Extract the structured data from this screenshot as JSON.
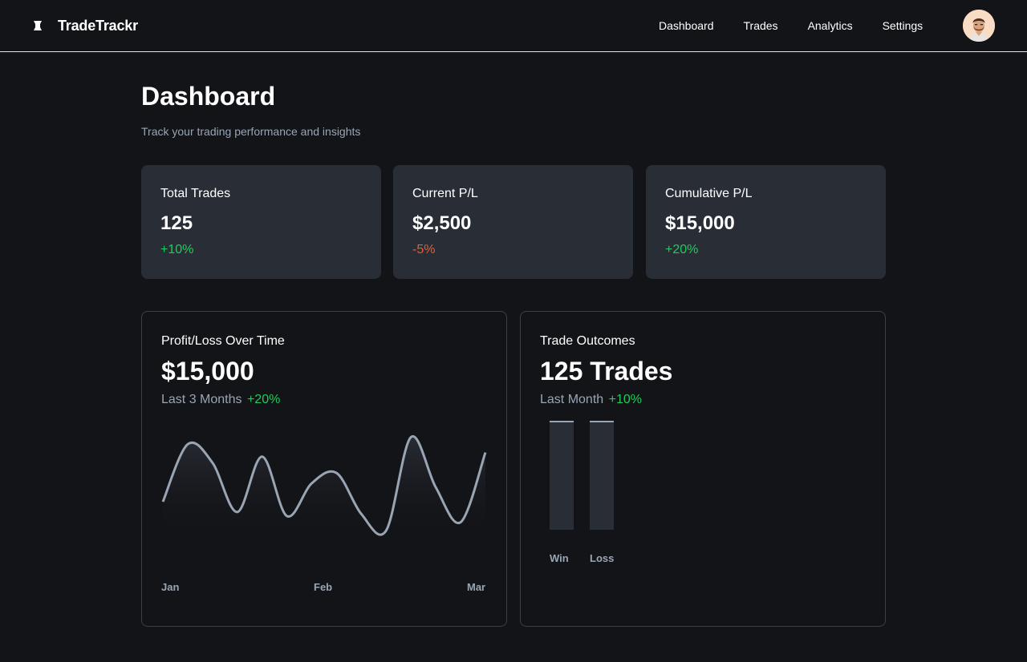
{
  "app": {
    "name": "TradeTrackr"
  },
  "nav": {
    "items": [
      "Dashboard",
      "Trades",
      "Analytics",
      "Settings"
    ]
  },
  "page": {
    "title": "Dashboard",
    "subtitle": "Track your trading performance and insights"
  },
  "stats": [
    {
      "label": "Total Trades",
      "value": "125",
      "change": "+10%",
      "trend": "up"
    },
    {
      "label": "Current P/L",
      "value": "$2,500",
      "change": "-5%",
      "trend": "down"
    },
    {
      "label": "Cumulative P/L",
      "value": "$15,000",
      "change": "+20%",
      "trend": "up"
    }
  ],
  "pl_panel": {
    "title": "Profit/Loss Over Time",
    "value": "$15,000",
    "period": "Last 3 Months",
    "change": "+20%"
  },
  "outcomes_panel": {
    "title": "Trade Outcomes",
    "value": "125 Trades",
    "period": "Last Month",
    "change": "+10%"
  },
  "colors": {
    "positive": "#1fcb5a",
    "negative": "#ec5a2d",
    "card": "#292e36",
    "background": "#131418"
  },
  "chart_data": [
    {
      "type": "area",
      "x_labels": [
        "Jan",
        "Feb",
        "Mar"
      ],
      "values": [
        32,
        88,
        70,
        22,
        76,
        18,
        50,
        60,
        20,
        4,
        95,
        46,
        12,
        80
      ],
      "ylim": [
        0,
        100
      ],
      "grid": false
    },
    {
      "type": "bar",
      "categories": [
        "Win",
        "Loss"
      ],
      "values": [
        100,
        100
      ],
      "ylim": [
        0,
        100
      ]
    }
  ]
}
